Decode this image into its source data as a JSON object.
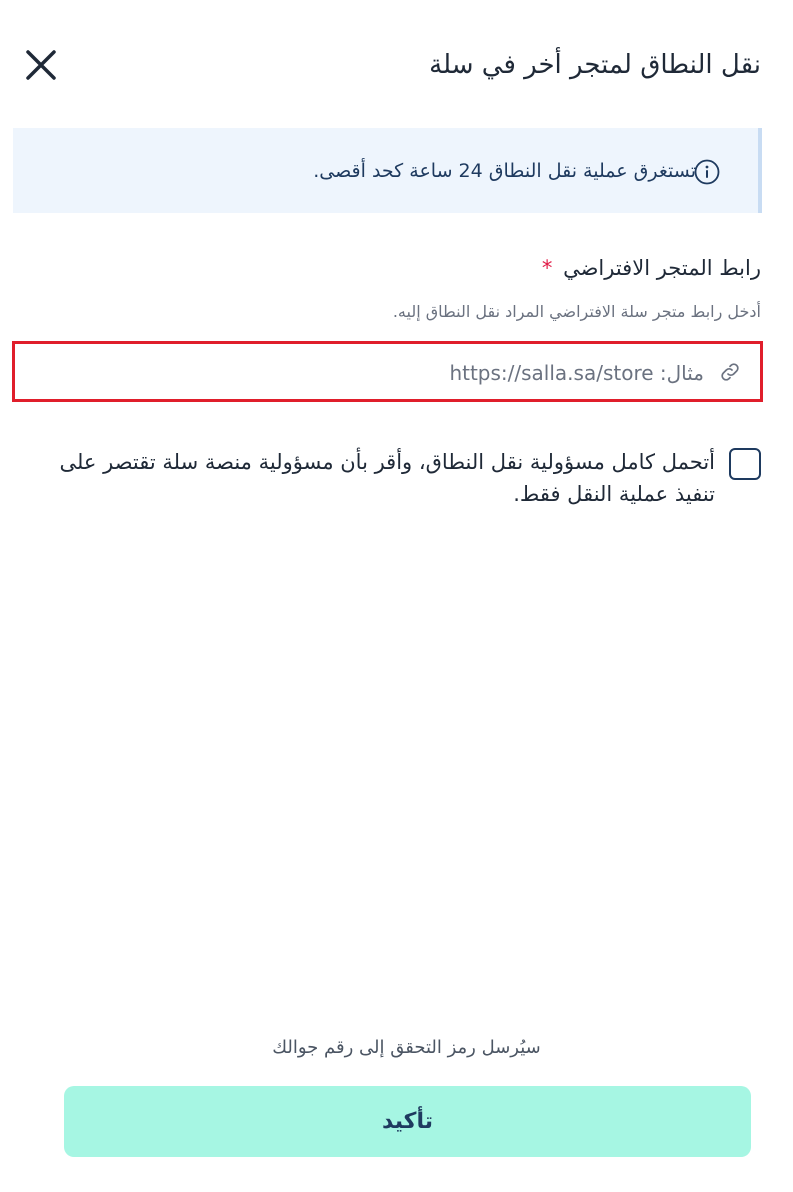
{
  "header": {
    "title": "نقل النطاق لمتجر أخر في سلة",
    "close_icon": "close-icon"
  },
  "info": {
    "icon": "info-icon",
    "text": "تستغرق عملية نقل النطاق 24 ساعة كحد أقصى."
  },
  "form": {
    "store_url_label": "رابط المتجر الافتراضي",
    "required_mark": "*",
    "store_url_hint": "أدخل رابط متجر سلة الافتراضي المراد نقل النطاق إليه.",
    "store_url_placeholder": "مثال: https://salla.sa/store",
    "store_url_value": "",
    "link_icon": "link-icon"
  },
  "consent": {
    "checked": false,
    "text": "أتحمل كامل مسؤولية نقل النطاق، وأقر بأن مسؤولية منصة سلة تقتصر على تنفيذ عملية النقل فقط."
  },
  "footer": {
    "otp_note": "سيُرسل رمز التحقق إلى رقم جوالك",
    "confirm_label": "تأكيد"
  },
  "colors": {
    "accent_button": "#a6f6e3",
    "info_background": "#eef5fd",
    "required": "#e11d48",
    "highlight_border": "#e01e2b",
    "text_dark": "#1e3a5f"
  }
}
